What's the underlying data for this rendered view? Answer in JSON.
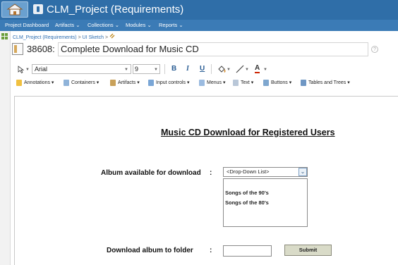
{
  "header": {
    "title": "CLM_Project (Requirements)"
  },
  "nav": {
    "items": [
      "Project Dashboard",
      "Artifacts",
      "Collections",
      "Modules",
      "Reports"
    ],
    "dropdown_mark": "⌄"
  },
  "breadcrumb": {
    "project": "CLM_Project (Requirements)",
    "separator": ">",
    "folder": "UI Sketch",
    "trail_separator": ">"
  },
  "artifact": {
    "id": "38608:",
    "name": "Complete Download for Music CD"
  },
  "toolbar": {
    "font": "Arial",
    "size": "9",
    "bold_label": "B",
    "italic_label": "I",
    "underline_label": "U",
    "font_color_label": "A"
  },
  "palette_menus": [
    "Annotations",
    "Containers",
    "Artifacts",
    "Input controls",
    "Menus",
    "Text",
    "Buttons",
    "Tables and Trees"
  ],
  "sketch": {
    "title": "Music CD Download for Registered Users",
    "album_label": "Album available for download",
    "colon": ":",
    "dropdown_placeholder": "<Drop-Down List>",
    "albums": [
      "Songs of the 90's",
      "Songs of the 80's"
    ],
    "folder_label": "Download album to folder",
    "submit_label": "Submit"
  },
  "colors": {
    "header": "#2f6ea8",
    "nav": "#3b7bb6",
    "link": "#2b6cb0"
  }
}
